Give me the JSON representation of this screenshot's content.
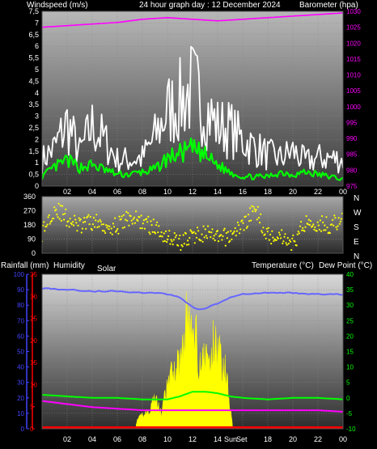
{
  "header": {
    "left": "Windspeed (m/s)",
    "center": "24 hour graph day : 12 December 2024",
    "right": "Barometer (hpa)"
  },
  "labels": {
    "rain": "Rainfall (mm)",
    "humidity": "Humidity",
    "solar": "Solar",
    "temperature": "Temperature (°C)",
    "dewpoint": "Dew Point (°C)",
    "sunrise": "Sunrise",
    "sunset": "Sunset",
    "sunrise_abbr": "Sun",
    "sunset_abbr": "Set"
  },
  "colors": {
    "wind_gust": "#ffffff",
    "wind_avg": "#00ff00",
    "barometer": "#ff00ff",
    "wind_dir": "#ffff00",
    "humidity": "#6666ff",
    "temperature": "#00ff00",
    "dewpoint": "#ff00ff",
    "solar": "#ffff00",
    "rain": "#ff0000",
    "temp_axis": "#00ff00",
    "rain_axis": "#ff0000",
    "humidity_axis": "#4444ff"
  },
  "chart_data": [
    {
      "type": "line",
      "panel": "wind",
      "x_ticks": [
        "02",
        "04",
        "06",
        "08",
        "10",
        "12",
        "14",
        "16",
        "18",
        "20",
        "22",
        "00"
      ],
      "y_left_ticks": [
        "0",
        "0,5",
        "1",
        "1,5",
        "2",
        "2,5",
        "3",
        "3,5",
        "4",
        "4,5",
        "5",
        "5,5",
        "6",
        "6,5",
        "7",
        "7,5"
      ],
      "y_left_range": [
        0,
        7.5
      ],
      "y_right_ticks": [
        "975",
        "980",
        "985",
        "990",
        "995",
        "1000",
        "1005",
        "1010",
        "1015",
        "1020",
        "1025",
        "1030"
      ],
      "y_right_range": [
        975,
        1030
      ],
      "x_range": [
        0,
        24
      ],
      "series": [
        {
          "key": "gust",
          "x": [
            0,
            1,
            2,
            3,
            4,
            5,
            6,
            7,
            8,
            9,
            10,
            11,
            12,
            13,
            14,
            15,
            16,
            17,
            18,
            19,
            20,
            21,
            22,
            23,
            24
          ],
          "y": [
            1.5,
            2.2,
            3.6,
            1.9,
            3.4,
            2.6,
            1.5,
            1.5,
            1.6,
            2.8,
            4.3,
            4.8,
            5.6,
            4.5,
            3.4,
            3.3,
            2.6,
            2.2,
            1.8,
            1.6,
            2.0,
            1.4,
            1.6,
            1.6,
            1.5
          ]
        },
        {
          "key": "avg",
          "x": [
            0,
            1,
            2,
            3,
            4,
            5,
            6,
            7,
            8,
            9,
            10,
            11,
            12,
            13,
            14,
            15,
            16,
            17,
            18,
            19,
            20,
            21,
            22,
            23,
            24
          ],
          "y": [
            0.4,
            0.8,
            1.1,
            0.8,
            0.9,
            0.7,
            0.5,
            0.5,
            0.6,
            0.7,
            1.2,
            1.4,
            1.6,
            1.3,
            0.9,
            0.6,
            0.4,
            0.4,
            0.4,
            0.6,
            0.5,
            0.6,
            0.5,
            0.4,
            0.3
          ]
        },
        {
          "key": "barometer",
          "x": [
            0,
            2,
            4,
            6,
            8,
            10,
            12,
            14,
            16,
            18,
            20,
            22,
            24
          ],
          "y": [
            1025,
            1025.5,
            1026,
            1026.5,
            1027.5,
            1028,
            1027.5,
            1027,
            1027.5,
            1028,
            1028.5,
            1029,
            1029.5
          ]
        }
      ]
    },
    {
      "type": "scatter",
      "panel": "wind_direction",
      "y_ticks": [
        "0",
        "90",
        "180",
        "270",
        "360"
      ],
      "y_range": [
        0,
        360
      ],
      "compass": [
        "N",
        "W",
        "S",
        "E",
        "N"
      ],
      "x": [
        0,
        1,
        2,
        3,
        4,
        5,
        6,
        7,
        8,
        9,
        10,
        11,
        12,
        13,
        14,
        15,
        16,
        17,
        18,
        19,
        20,
        21,
        22,
        23,
        24
      ],
      "y": [
        130,
        290,
        220,
        170,
        200,
        180,
        170,
        230,
        200,
        160,
        110,
        70,
        110,
        130,
        90,
        110,
        180,
        280,
        110,
        120,
        60,
        200,
        190,
        180,
        210
      ]
    },
    {
      "type": "line",
      "panel": "temperature",
      "y_humidity_ticks": [
        "0",
        "10",
        "20",
        "30",
        "40",
        "50",
        "60",
        "70",
        "80",
        "90",
        "100"
      ],
      "y_humidity_range": [
        0,
        100
      ],
      "y_rain_ticks": [
        "0",
        "5",
        "10",
        "15",
        "20",
        "25",
        "30",
        "35"
      ],
      "y_rain_range": [
        0,
        35
      ],
      "y_temp_ticks": [
        "-10",
        "-5",
        "0",
        "5",
        "10",
        "15",
        "20",
        "25",
        "30",
        "35",
        "40"
      ],
      "y_temp_range": [
        -10,
        40
      ],
      "x_ticks": [
        "02",
        "04",
        "06",
        "08",
        "10",
        "12",
        "14",
        "16",
        "18",
        "20",
        "22",
        "00"
      ],
      "series": [
        {
          "key": "humidity",
          "x": [
            0,
            2,
            4,
            6,
            8,
            9,
            10,
            11,
            12,
            12.5,
            13,
            14,
            15,
            16,
            18,
            20,
            22,
            24
          ],
          "y": [
            91,
            90,
            89,
            89,
            88,
            88,
            87,
            85,
            79,
            77,
            78,
            81,
            85,
            87,
            88,
            88,
            87,
            87
          ]
        },
        {
          "key": "temperature",
          "x": [
            0,
            2,
            4,
            6,
            8,
            10,
            11,
            12,
            13,
            14,
            15,
            16,
            18,
            20,
            22,
            24
          ],
          "y": [
            1,
            0.5,
            0,
            0,
            -0.5,
            -0.5,
            0.5,
            2,
            2,
            1.5,
            0.5,
            0,
            -0.5,
            0,
            0,
            -0.5
          ]
        },
        {
          "key": "dewpoint",
          "x": [
            0,
            2,
            4,
            6,
            8,
            10,
            12,
            14,
            16,
            18,
            20,
            22,
            24
          ],
          "y": [
            -1,
            -2,
            -3,
            -3.5,
            -4,
            -4,
            -4,
            -4,
            -4,
            -4,
            -4,
            -4,
            -4.5
          ]
        },
        {
          "key": "solar",
          "x": [
            7.5,
            8,
            8.5,
            9,
            9.5,
            10,
            10.5,
            11,
            11.3,
            11.6,
            11.9,
            12.2,
            12.5,
            12.8,
            13.1,
            13.4,
            13.7,
            14,
            14.3,
            14.6,
            14.9,
            15.2
          ],
          "y": [
            2,
            5,
            6,
            11,
            5,
            15,
            21,
            23,
            32,
            41,
            31,
            37,
            23,
            23,
            26,
            22,
            31,
            29,
            23,
            22,
            12,
            2
          ]
        },
        {
          "key": "rain",
          "x": [
            0,
            24
          ],
          "y": [
            0,
            0
          ]
        }
      ]
    }
  ]
}
